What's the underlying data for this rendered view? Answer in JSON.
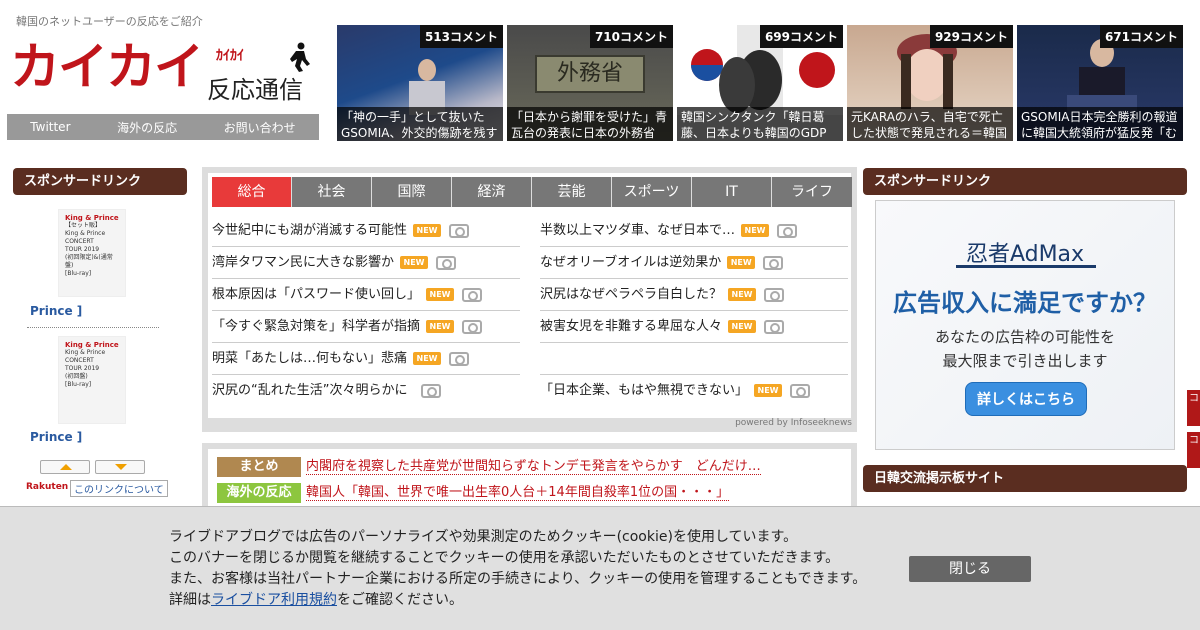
{
  "header": {
    "tagline": "韓国のネットユーザーの反応をご紹介",
    "logo_main": "カイカイ",
    "logo_kana": "ｶｲｶｲ",
    "logo_sub": "反応通信",
    "nav": [
      "Twitter",
      "海外の反応",
      "お問い合わせ"
    ]
  },
  "thumbs": [
    {
      "count": "513コメント",
      "caption": "「神の一手」として抜いたGSOMIA、外交的傷跡を残す"
    },
    {
      "count": "710コメント",
      "caption": "「日本から謝罪を受けた」青瓦台の発表に日本の外務省"
    },
    {
      "count": "699コメント",
      "caption": "韓国シンクタンク「韓日葛藤、日本よりも韓国のGDP"
    },
    {
      "count": "929コメント",
      "caption": "元KARAのハラ、自宅で死亡した状態で発見される＝韓国"
    },
    {
      "count": "671コメント",
      "caption": "GSOMIA日本完全勝利の報道に韓国大統領府が猛反発「む"
    }
  ],
  "left_sidebar": {
    "heading": "スポンサードリンク",
    "products": [
      {
        "img_lines": [
          "King & Prince",
          "【セット販】",
          "King & Prince",
          "CONCERT",
          "TOUR 2019",
          "(初回限定)&(通常盤)",
          "[Blu-ray]"
        ],
        "link": "Prince ]"
      },
      {
        "img_lines": [
          "King & Prince",
          "King & Prince",
          "CONCERT",
          "TOUR 2019",
          "(初回盤)",
          "[Blu-ray]"
        ],
        "link": "Prince ]"
      }
    ],
    "rakuten": "Rakuten",
    "about_link": "このリンクについて"
  },
  "news": {
    "tabs": [
      "総合",
      "社会",
      "国際",
      "経済",
      "芸能",
      "スポーツ",
      "IT",
      "ライフ"
    ],
    "new_label": "NEW",
    "left": [
      {
        "title": "今世紀中にも湖が消滅する可能性",
        "new": true
      },
      {
        "title": "湾岸タワマン民に大きな影響か",
        "new": true
      },
      {
        "title": "根本原因は「パスワード使い回し」",
        "new": true
      },
      {
        "title": "「今すぐ緊急対策を」科学者が指摘",
        "new": true
      },
      {
        "title": "明菜「あたしは…何もない」悲痛",
        "new": true
      },
      {
        "title": "沢尻の“乱れた生活”次々明らかに",
        "new": false
      }
    ],
    "right": [
      {
        "title": "半数以上マツダ車、なぜ日本で…",
        "new": true
      },
      {
        "title": "なぜオリーブオイルは逆効果か",
        "new": true
      },
      {
        "title": "沢尻はなぜペラペラ自白した？",
        "new": true
      },
      {
        "title": "被害女児を非難する卑屈な人々",
        "new": true
      },
      {
        "title": "",
        "new": false
      },
      {
        "title": "「日本企業、もはや無視できない」",
        "new": true
      }
    ],
    "powered": "powered by Infoseeknews"
  },
  "summary": [
    {
      "category": "まとめ",
      "text": "内閣府を視察した共産党が世間知らずなトンデモ発言をやらかす　どんだけ…"
    },
    {
      "category": "海外の反応",
      "text": "韓国人「韓国、世界で唯一出生率0人台＋14年間自殺率1位の国・・・」"
    }
  ],
  "right_sidebar": {
    "heading": "スポンサードリンク",
    "ad": {
      "brand": "忍者AdMax",
      "headline": "広告収入に満足ですか？",
      "body1": "あなたの広告枠の可能性を",
      "body2": "最大限まで引き出します",
      "button": "詳しくはこちら"
    },
    "heading2": "日韓交流掲示板サイト",
    "edge_tabs": [
      "コ",
      "コ"
    ]
  },
  "cookie": {
    "line1": "ライブドアブログでは広告のパーソナライズや効果測定のためクッキー(cookie)を使用しています。",
    "line2": "このバナーを閉じるか閲覧を継続することでクッキーの使用を承認いただいたものとさせていただきます。",
    "line3": "また、お客様は当社パートナー企業における所定の手続きにより、クッキーの使用を管理することもできます。",
    "line4_pre": "詳細は",
    "line4_link": "ライブドア利用規約",
    "line4_post": "をご確認ください。",
    "close": "閉じる"
  },
  "colors": {
    "brand_red": "#c0151b",
    "sidebar_head": "#5a2d20",
    "tab_active": "#e83a3a",
    "new_badge": "#f5a623"
  }
}
